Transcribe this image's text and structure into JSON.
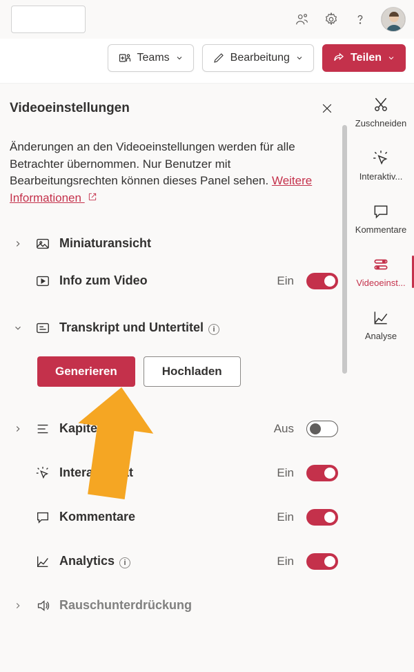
{
  "topbar": {
    "searchPlaceholder": ""
  },
  "actionbar": {
    "teams": "Teams",
    "edit": "Bearbeitung",
    "share": "Teilen"
  },
  "panel": {
    "title": "Videoeinstellungen",
    "description": "Änderungen an den Videoeinstellungen werden für alle Betrachter übernommen. Nur Benutzer mit Bearbeitungsrechten können dieses Panel sehen.",
    "moreInfo": "Weitere Informationen",
    "rows": {
      "thumbnail": {
        "label": "Miniaturansicht"
      },
      "about": {
        "label": "Info zum Video",
        "state": "Ein"
      },
      "transcript": {
        "label": "Transkript und Untertitel"
      },
      "generate": "Generieren",
      "upload": "Hochladen",
      "chapters": {
        "label": "Kapitel",
        "state": "Aus"
      },
      "interactivity": {
        "label": "Interaktivität",
        "state": "Ein"
      },
      "comments": {
        "label": "Kommentare",
        "state": "Ein"
      },
      "analytics": {
        "label": "Analytics",
        "state": "Ein"
      },
      "noise": {
        "label": "Rauschunterdrückung"
      }
    }
  },
  "sidebar": {
    "trim": "Zuschneiden",
    "interactivity": "Interaktiv...",
    "comments": "Kommentare",
    "settings": "Videoeinst...",
    "analytics": "Analyse"
  },
  "colors": {
    "accent": "#C4314B",
    "annotation": "#F5A623"
  }
}
